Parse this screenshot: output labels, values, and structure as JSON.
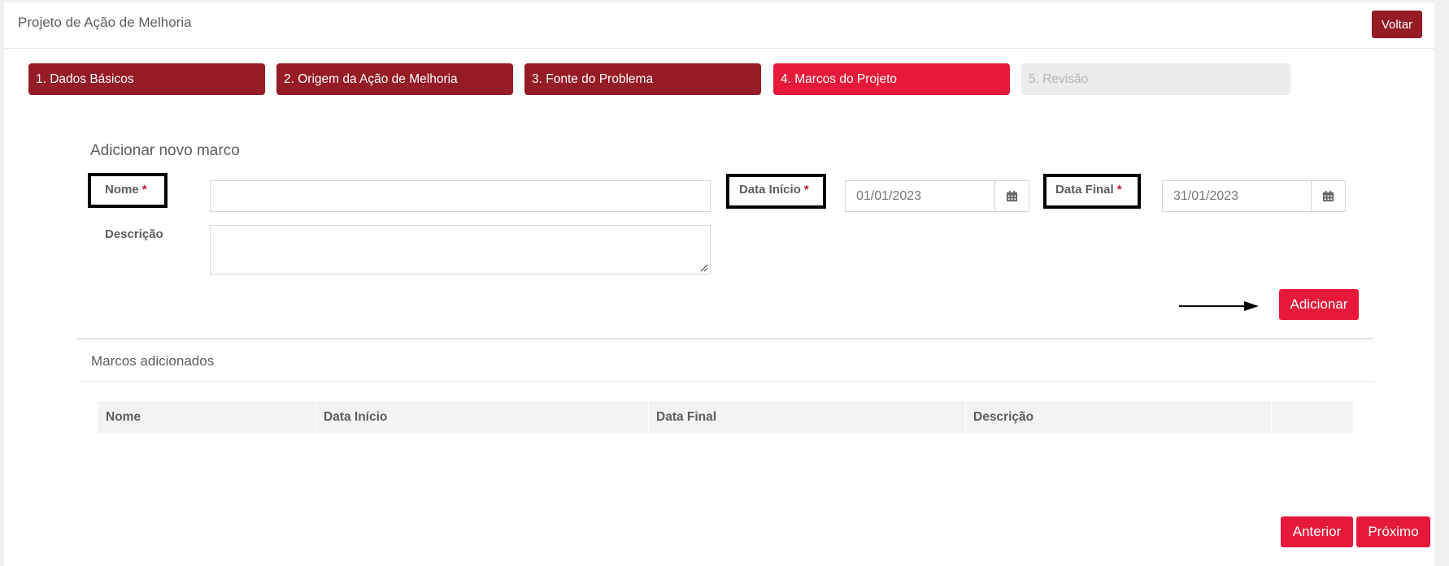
{
  "header": {
    "title": "Projeto de Ação de Melhoria",
    "back_label": "Voltar"
  },
  "steps": [
    {
      "label": "1. Dados Básicos",
      "state": "done"
    },
    {
      "label": "2. Origem da Ação de Melhoria",
      "state": "done"
    },
    {
      "label": "3. Fonte do Problema",
      "state": "done"
    },
    {
      "label": "4. Marcos do Projeto",
      "state": "active"
    },
    {
      "label": "5. Revisão",
      "state": "pending"
    }
  ],
  "form": {
    "title": "Adicionar novo marco",
    "nome_label": "Nome",
    "nome_value": "",
    "descricao_label": "Descrição",
    "descricao_value": "",
    "data_inicio_label": "Data Início",
    "data_inicio_value": "01/01/2023",
    "data_final_label": "Data Final",
    "data_final_value": "31/01/2023",
    "required_marker": "*",
    "add_label": "Adicionar"
  },
  "milestones": {
    "title": "Marcos adicionados",
    "columns": [
      "Nome",
      "Data Início",
      "Data Final",
      "Descrição",
      ""
    ],
    "rows": []
  },
  "footer": {
    "previous_label": "Anterior",
    "next_label": "Próximo"
  },
  "colors": {
    "step_done": "#951b24",
    "step_active": "#e7193a",
    "step_pending": "#ececec",
    "button_primary": "#e7193a",
    "required": "#c8102e"
  },
  "icons": {
    "calendar": "calendar-icon",
    "arrow": "arrow-right-icon"
  }
}
